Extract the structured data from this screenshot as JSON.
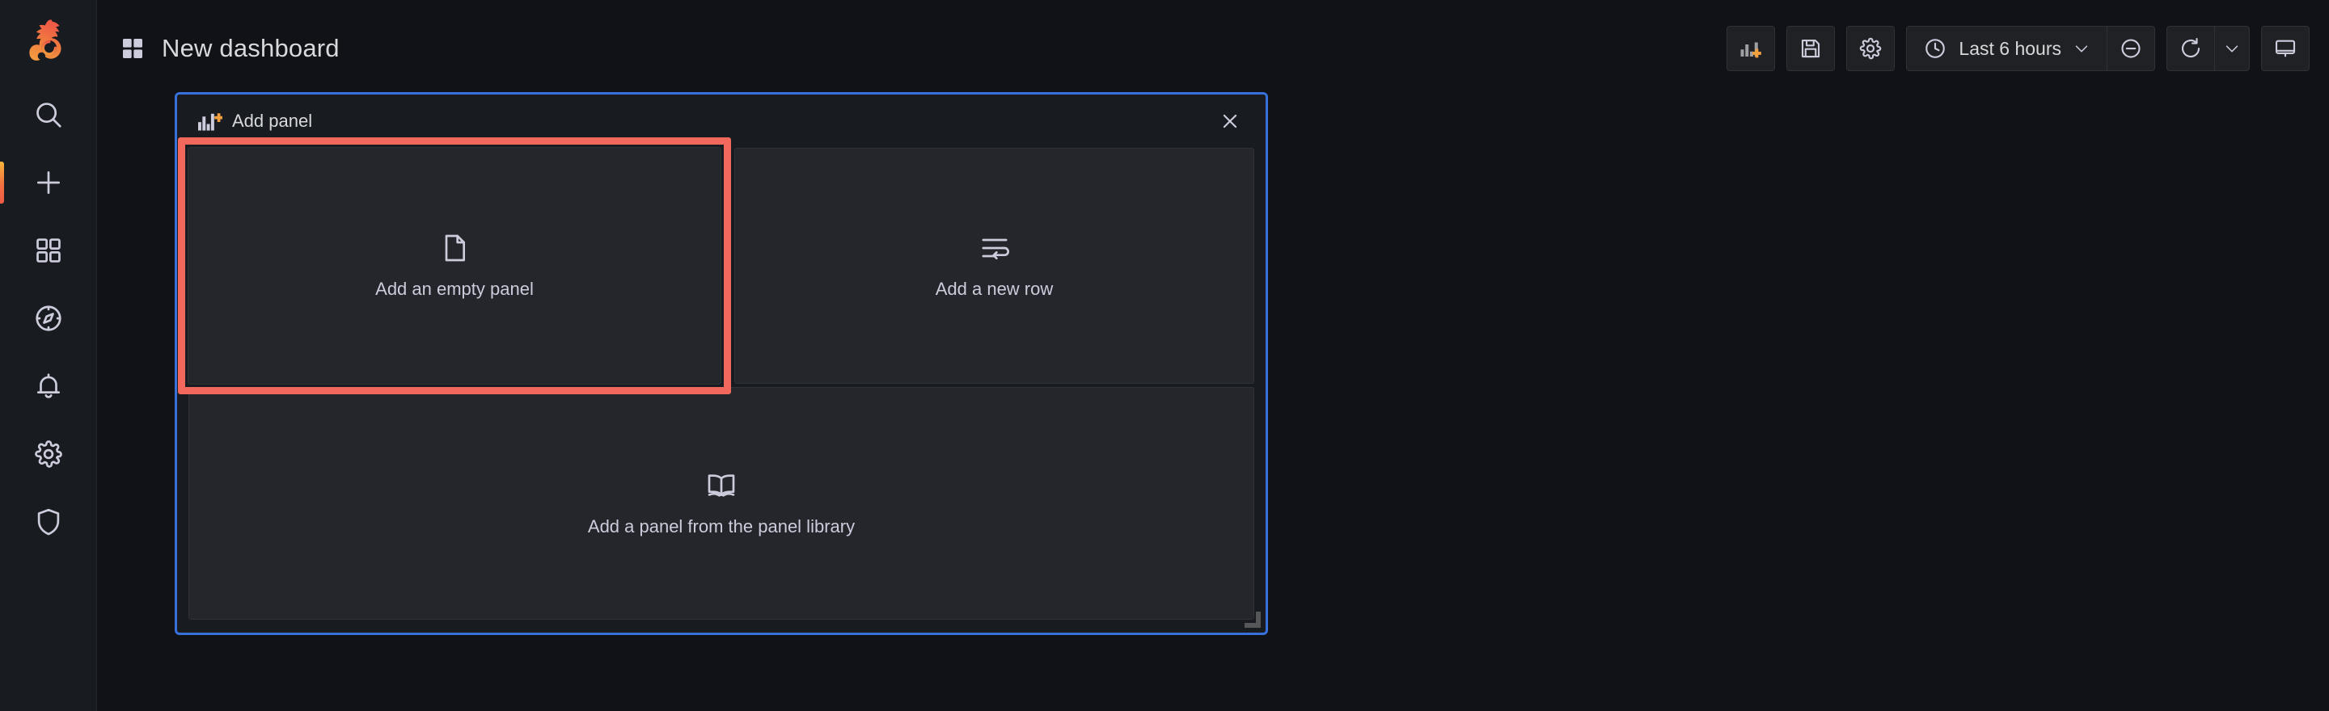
{
  "app": {
    "logo_icon": "grafana-logo",
    "background": "#111217"
  },
  "sidebar": {
    "items": [
      {
        "id": "search",
        "icon": "search-icon",
        "label": "Search",
        "active": false
      },
      {
        "id": "create",
        "icon": "plus-icon",
        "label": "Create",
        "active": true
      },
      {
        "id": "dashboards",
        "icon": "apps-grid-icon",
        "label": "Dashboards",
        "active": false
      },
      {
        "id": "explore",
        "icon": "compass-icon",
        "label": "Explore",
        "active": false
      },
      {
        "id": "alerting",
        "icon": "bell-icon",
        "label": "Alerting",
        "active": false
      },
      {
        "id": "config",
        "icon": "gear-icon",
        "label": "Configuration",
        "active": false
      },
      {
        "id": "admin",
        "icon": "shield-icon",
        "label": "Server Admin",
        "active": false
      }
    ],
    "active_indicator_color": "#F2703F"
  },
  "header": {
    "breadcrumb_icon": "apps-grid-icon",
    "title": "New dashboard"
  },
  "toolbar": {
    "add_panel": {
      "label": "Add panel",
      "icon": "add-panel-icon",
      "accent": "#F2A03F"
    },
    "save": {
      "label": "Save dashboard",
      "icon": "save-floppy-icon"
    },
    "settings": {
      "label": "Dashboard settings",
      "icon": "gear-icon"
    },
    "time_picker": {
      "icon": "clock-icon",
      "value": "Last 6 hours",
      "chevron": "chevron-down-icon"
    },
    "zoom_out": {
      "label": "Zoom out time range",
      "icon": "zoom-out-icon"
    },
    "refresh": {
      "label": "Refresh dashboard",
      "icon": "refresh-icon",
      "chevron": "chevron-down-icon"
    },
    "kiosk": {
      "label": "Cycle view mode",
      "icon": "monitor-icon"
    }
  },
  "add_panel_widget": {
    "icon": "add-panel-icon",
    "title": "Add panel",
    "close_icon": "close-icon",
    "border_color": "#3871DC",
    "highlight_color": "#F2685C",
    "options": [
      {
        "id": "empty-panel",
        "icon": "file-icon",
        "label": "Add an empty panel",
        "highlighted": true
      },
      {
        "id": "new-row",
        "icon": "wrap-text-icon",
        "label": "Add a new row",
        "highlighted": false
      },
      {
        "id": "panel-library",
        "icon": "book-open-icon",
        "label": "Add a panel from the panel library",
        "highlighted": false
      }
    ]
  }
}
